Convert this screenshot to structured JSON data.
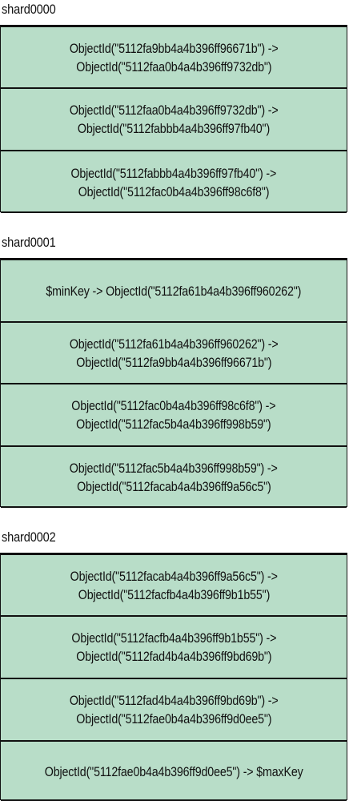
{
  "colors": {
    "chunk_fill": "#b8ddc8",
    "border": "#111111",
    "text": "#111111"
  },
  "shards": [
    {
      "name": "shard0000",
      "chunks": [
        [
          "ObjectId(\"5112fa9bb4a4b396ff96671b\") ->",
          "ObjectId(\"5112faa0b4a4b396ff9732db\")"
        ],
        [
          "ObjectId(\"5112faa0b4a4b396ff9732db\") ->",
          "ObjectId(\"5112fabbb4a4b396ff97fb40\")"
        ],
        [
          "ObjectId(\"5112fabbb4a4b396ff97fb40\") ->",
          "ObjectId(\"5112fac0b4a4b396ff98c6f8\")"
        ]
      ]
    },
    {
      "name": "shard0001",
      "chunks": [
        [
          "$minKey -> ObjectId(\"5112fa61b4a4b396ff960262\")"
        ],
        [
          "ObjectId(\"5112fa61b4a4b396ff960262\") ->",
          "ObjectId(\"5112fa9bb4a4b396ff96671b\")"
        ],
        [
          "ObjectId(\"5112fac0b4a4b396ff98c6f8\") ->",
          "ObjectId(\"5112fac5b4a4b396ff998b59\")"
        ],
        [
          "ObjectId(\"5112fac5b4a4b396ff998b59\") ->",
          "ObjectId(\"5112facab4a4b396ff9a56c5\")"
        ]
      ]
    },
    {
      "name": "shard0002",
      "chunks": [
        [
          "ObjectId(\"5112facab4a4b396ff9a56c5\") ->",
          "ObjectId(\"5112facfb4a4b396ff9b1b55\")"
        ],
        [
          "ObjectId(\"5112facfb4a4b396ff9b1b55\") ->",
          "ObjectId(\"5112fad4b4a4b396ff9bd69b\")"
        ],
        [
          "ObjectId(\"5112fad4b4a4b396ff9bd69b\") ->",
          "ObjectId(\"5112fae0b4a4b396ff9d0ee5\")"
        ],
        [
          "ObjectId(\"5112fae0b4a4b396ff9d0ee5\") -> $maxKey"
        ]
      ]
    }
  ]
}
